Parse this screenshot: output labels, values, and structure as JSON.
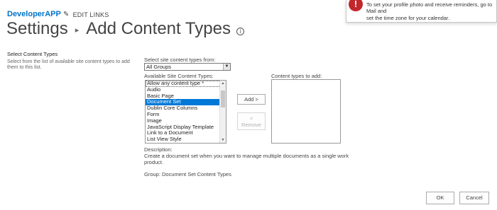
{
  "app": {
    "site_name": "DeveloperAPP",
    "edit_links": "EDIT LINKS",
    "breadcrumb_root": "Settings",
    "breadcrumb_sep": "▸",
    "page_title": "Add Content Types",
    "info_glyph": "i"
  },
  "notification": {
    "line1": "To set your profile photo and receive reminders, go to Mail and",
    "line2": "set the time zone for your calendar."
  },
  "section": {
    "title": "Select Content Types",
    "description": "Select from the list of available site content types to add them to this list."
  },
  "source": {
    "label": "Select site content types from:",
    "selected": "All Groups"
  },
  "available": {
    "label": "Available Site Content Types:",
    "options": [
      "Allow any content type *",
      "Audio",
      "Basic Page",
      "Document Set",
      "Dublin Core Columns",
      "Form",
      "Image",
      "JavaScript Display Template",
      "Link to a Document",
      "List View Style"
    ],
    "selected_index": 3
  },
  "buttons": {
    "add": "Add >",
    "remove_arrow": "<",
    "remove": "Remove",
    "ok": "OK",
    "cancel": "Cancel"
  },
  "target": {
    "label": "Content types to add:"
  },
  "description": {
    "label": "Description:",
    "text": "Create a document set when you want to manage multiple documents as a single work product.",
    "group": "Group: Document Set Content Types"
  },
  "icons": {
    "warning": "!",
    "scroll_up": "▲",
    "scroll_down": "▼",
    "dropdown": "▼",
    "pencil": "✎"
  }
}
